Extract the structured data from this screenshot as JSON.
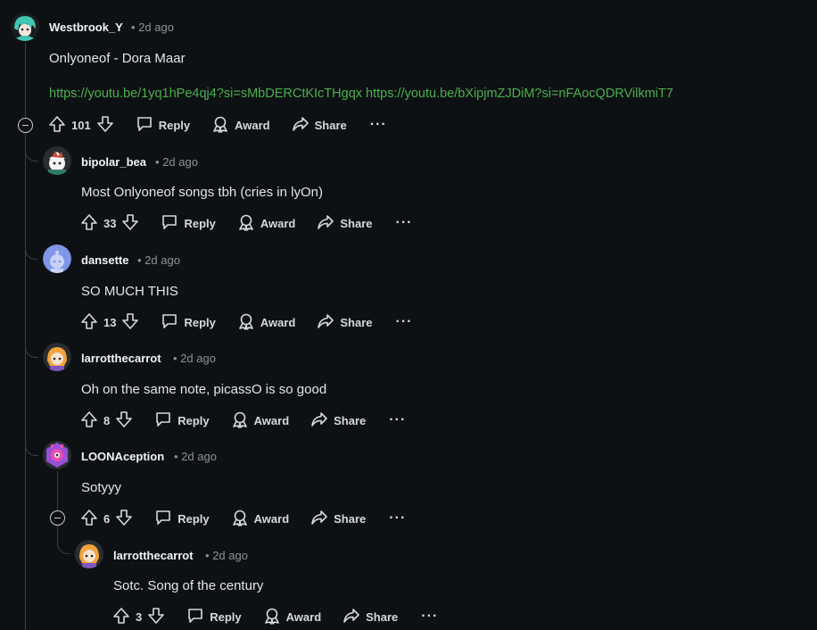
{
  "comments": [
    {
      "username": "Westbrook_Y",
      "time": "2d ago",
      "body": "Onlyoneof - Dora Maar",
      "links": [
        "https://youtu.be/1yq1hPe4qj4?si=sMbDERCtKIcTHgqx",
        "https://youtu.be/bXipjmZJDiM?si=nFAocQDRVilkmiT7"
      ],
      "score": "101"
    },
    {
      "username": "bipolar_bea",
      "time": "2d ago",
      "body": "Most Onlyoneof songs tbh (cries in lyOn)",
      "score": "33"
    },
    {
      "username": "dansette",
      "time": "2d ago",
      "body": "SO MUCH THIS",
      "score": "13"
    },
    {
      "username": "larrotthecarrot",
      "time": "2d ago",
      "body": "Oh on the same note, picassO is so good",
      "score": "8"
    },
    {
      "username": "LOONAception",
      "time": "2d ago",
      "body": "Sotyyy",
      "score": "6"
    },
    {
      "username": "larrotthecarrot",
      "time": "2d ago",
      "body": "Sotc. Song of the century",
      "score": "3"
    }
  ],
  "actions": {
    "reply": "Reply",
    "award": "Award",
    "share": "Share",
    "more": "···"
  },
  "meta_separator": "•",
  "colors": {
    "background": "#0e1113",
    "link": "#4caf50",
    "thread_line": "#3a3f42"
  },
  "icons": [
    "upvote-icon",
    "downvote-icon",
    "reply-icon",
    "award-icon",
    "share-icon",
    "more-icon",
    "collapse-icon"
  ]
}
